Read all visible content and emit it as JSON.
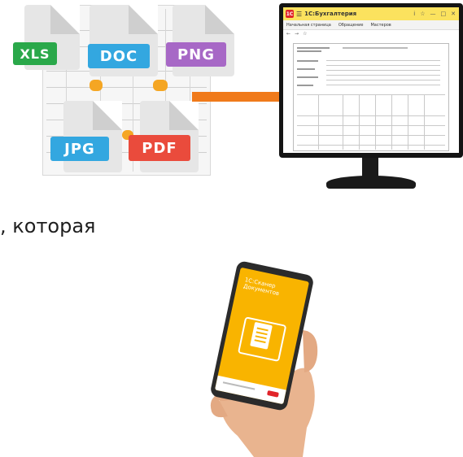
{
  "file_badges": [
    {
      "label": "XLS",
      "color": "#2aa84a"
    },
    {
      "label": "DOC",
      "color": "#33a7e0"
    },
    {
      "label": "PNG",
      "color": "#a768c6"
    },
    {
      "label": "JPG",
      "color": "#33a7e0"
    },
    {
      "label": "PDF",
      "color": "#ea4b3c"
    }
  ],
  "accent_color": "#f07a1a",
  "monitor": {
    "app_logo": "1C",
    "menu_icon": "☰",
    "app_title": "1С:Бухгалтерия",
    "window_controls": [
      "i",
      "☆",
      "—",
      "□",
      "✕"
    ],
    "nav_items": [
      "Начальная страница",
      "Обращение",
      "Мастеров"
    ]
  },
  "text_fragment": ", которая",
  "phone": {
    "app_title": "1С:Сканер Документов"
  }
}
